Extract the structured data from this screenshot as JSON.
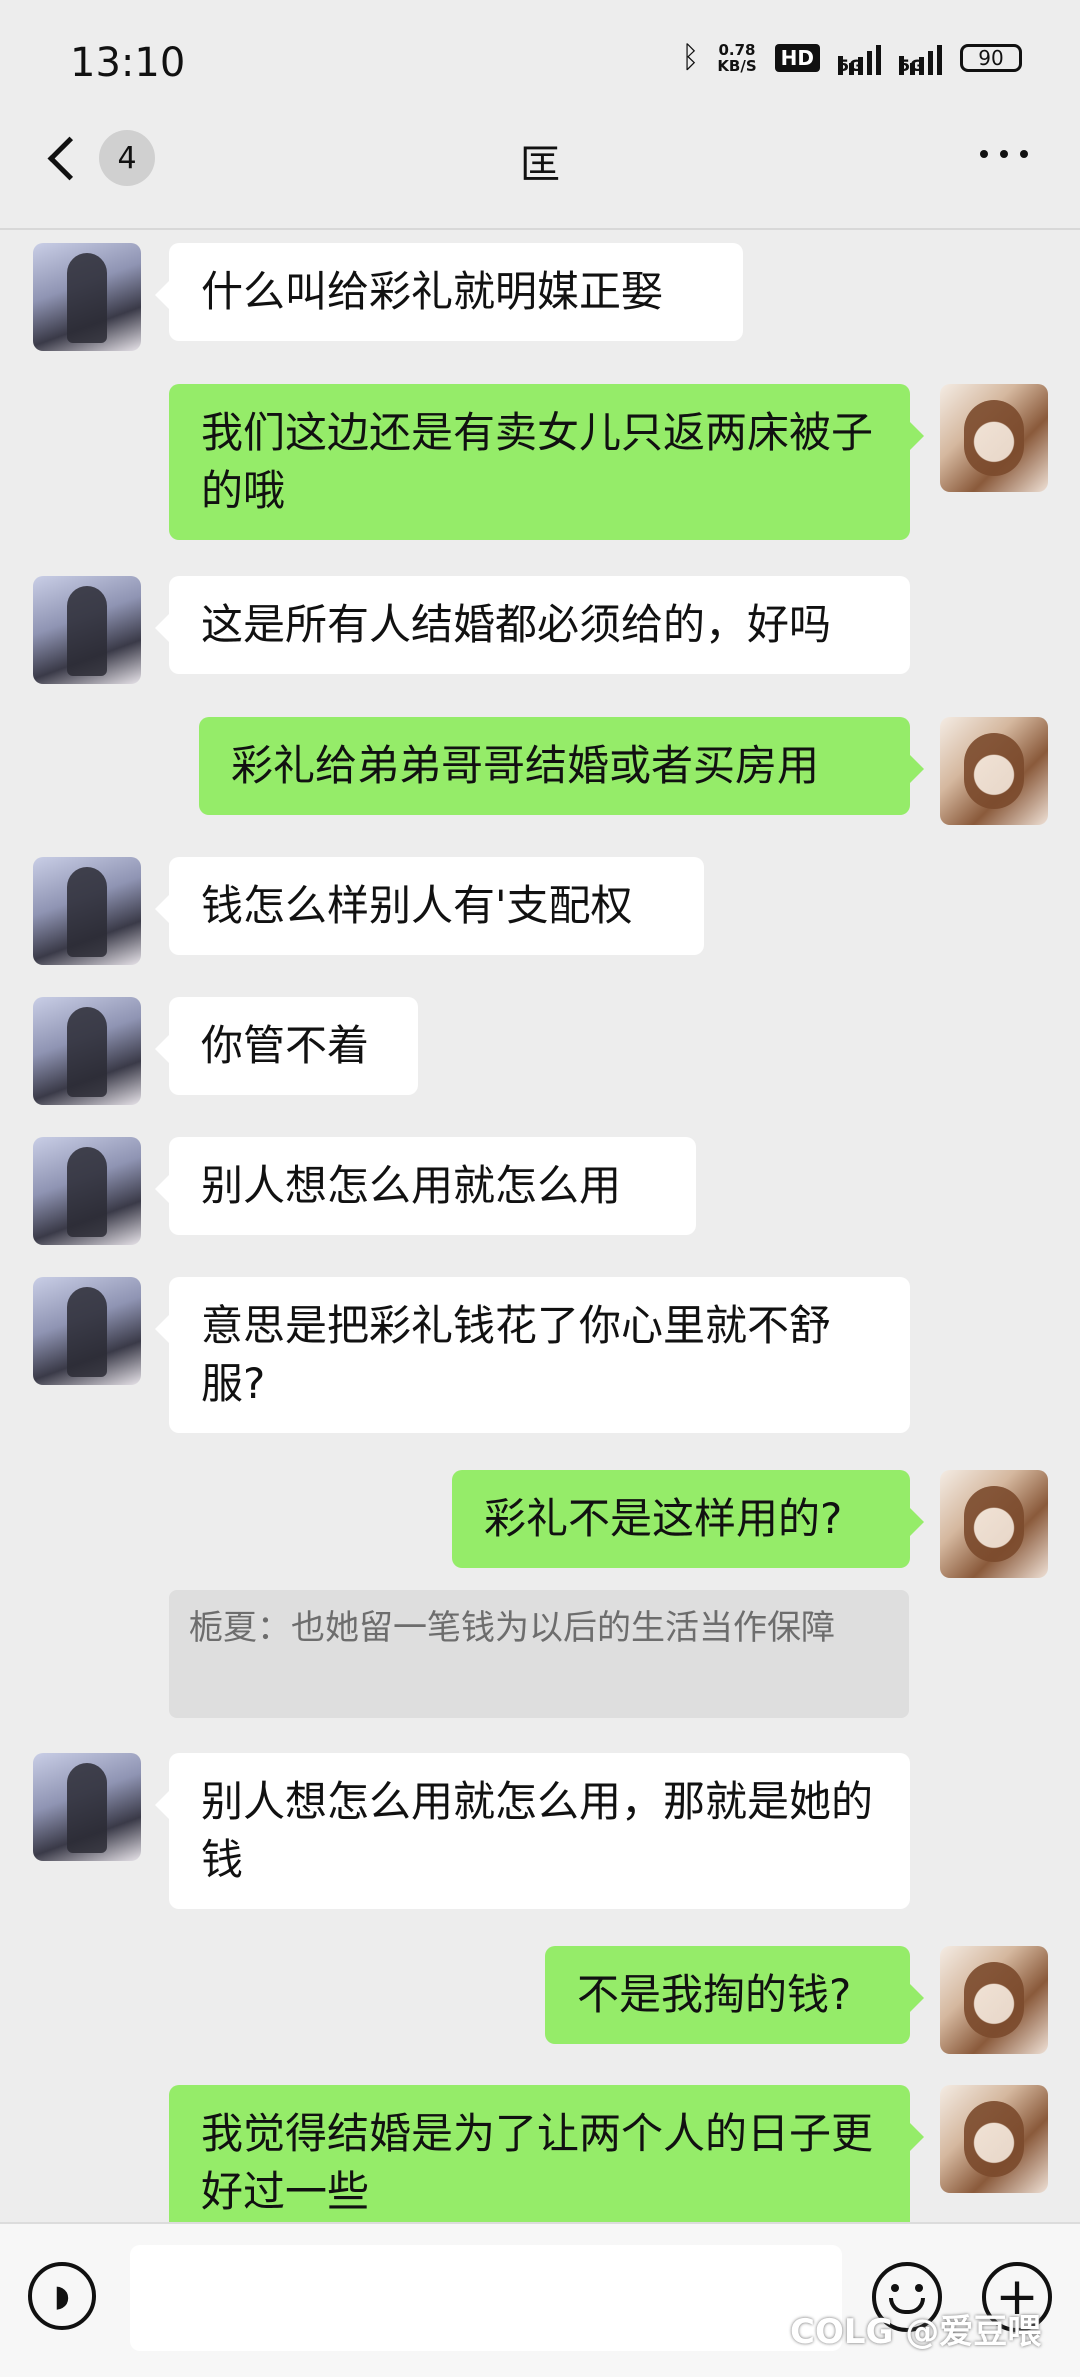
{
  "status_bar": {
    "time": "13:10",
    "net_speed": "0.78",
    "net_unit": "KB/S",
    "hd_label": "HD",
    "sim1": "5G",
    "sim2": "5G",
    "battery": "90"
  },
  "header": {
    "back_badge": "4",
    "title": "匡",
    "more_icon": "more-dots-icon"
  },
  "messages": [
    {
      "side": "left",
      "text": "什么叫给彩礼就明媒正娶"
    },
    {
      "side": "right",
      "text": "我们这边还是有卖女儿只返两床被子的哦"
    },
    {
      "side": "left",
      "text": "这是所有人结婚都必须给的，好吗"
    },
    {
      "side": "right",
      "text": "彩礼给弟弟哥哥结婚或者买房用"
    },
    {
      "side": "left",
      "text": "钱怎么样别人有'支配权"
    },
    {
      "side": "left",
      "text": "你管不着"
    },
    {
      "side": "left",
      "text": "别人想怎么用就怎么用"
    },
    {
      "side": "left",
      "text": "意思是把彩礼钱花了你心里就不舒服?"
    },
    {
      "side": "right",
      "text": "彩礼不是这样用的?"
    },
    {
      "side": "left",
      "text": "别人想怎么用就怎么用，那就是她的钱"
    },
    {
      "side": "right",
      "text": "不是我掏的钱?"
    },
    {
      "side": "right",
      "text": "我觉得结婚是为了让两个人的日子更好过一些"
    }
  ],
  "quote": {
    "text": "栀夏：也她留一笔钱为以后的生活当作保障"
  },
  "bottom_bar": {
    "voice_icon": "voice-icon",
    "emoji_icon": "emoji-icon",
    "plus_icon": "plus-icon",
    "plus_glyph": "+",
    "voice_glyph": "◗"
  },
  "watermark": "COLG @爱豆喂",
  "colors": {
    "bubble_self": "#95ec69",
    "bubble_other": "#ffffff",
    "background": "#ededed"
  }
}
